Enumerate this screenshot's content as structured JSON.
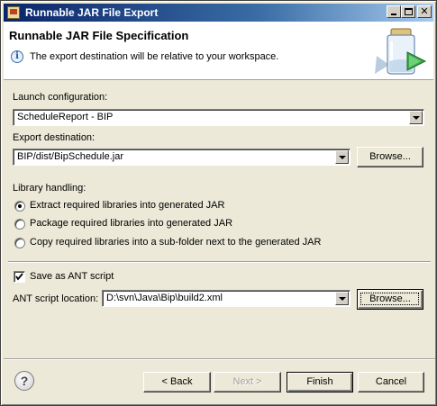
{
  "window": {
    "title": "Runnable JAR File Export"
  },
  "banner": {
    "title": "Runnable JAR File Specification",
    "message": "The export destination will be relative to your workspace."
  },
  "launch": {
    "label": "Launch configuration:",
    "value": "ScheduleReport - BIP"
  },
  "export": {
    "label": "Export destination:",
    "value": "BIP/dist/BipSchedule.jar",
    "browse_label": "Browse..."
  },
  "library": {
    "label": "Library handling:",
    "options": [
      {
        "label": "Extract required libraries into generated JAR",
        "checked": true
      },
      {
        "label": "Package required libraries into generated JAR",
        "checked": false
      },
      {
        "label": "Copy required libraries into a sub-folder next to the generated JAR",
        "checked": false
      }
    ]
  },
  "ant": {
    "checkbox_label": "Save as ANT script",
    "checked": true,
    "location_label": "ANT script location:",
    "location_value": "D:\\svn\\Java\\Bip\\build2.xml",
    "browse_label": "Browse..."
  },
  "footer": {
    "back_label": "< Back",
    "next_label": "Next >",
    "finish_label": "Finish",
    "cancel_label": "Cancel",
    "help_glyph": "?"
  },
  "icons": {
    "info": "info-icon",
    "help": "help-icon",
    "jar": "jar-wizard-icon"
  }
}
